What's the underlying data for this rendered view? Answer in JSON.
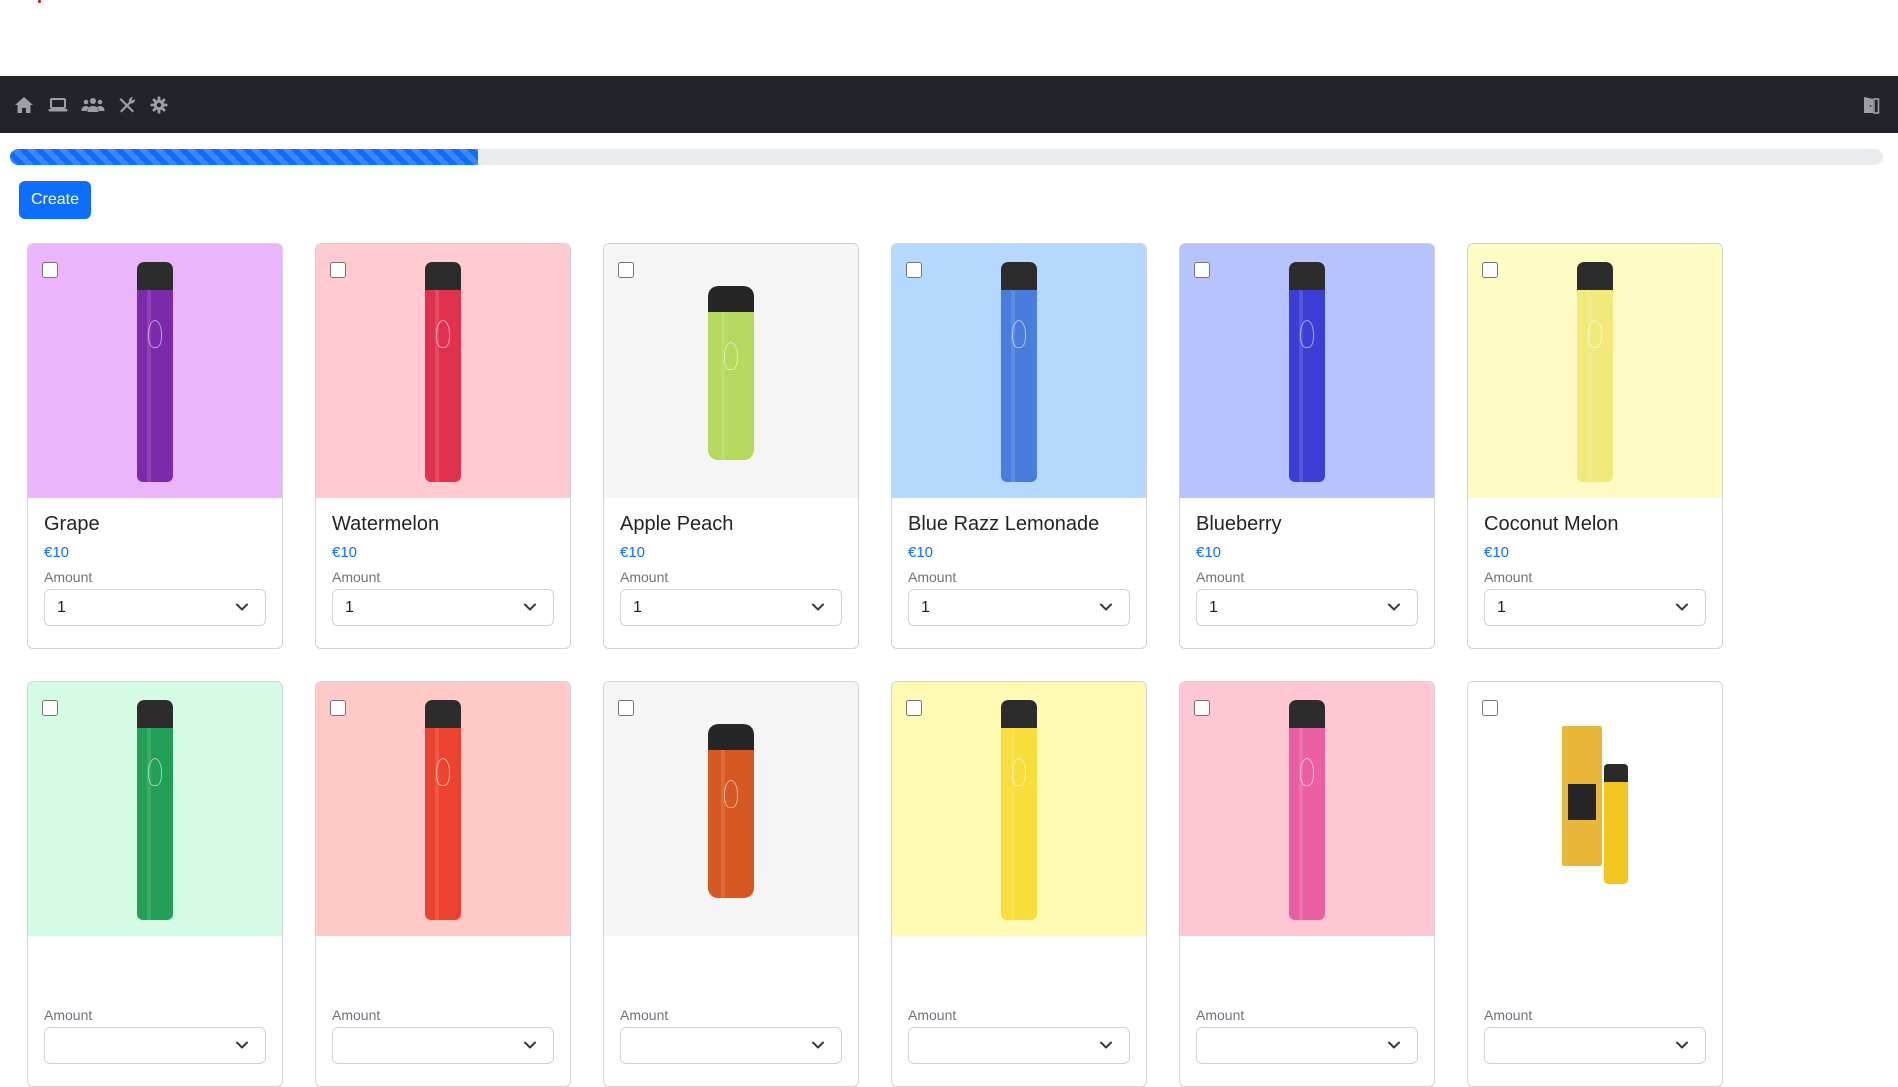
{
  "nav": {
    "icons": [
      "home-icon",
      "laptop-icon",
      "users-icon",
      "tools-icon",
      "gear-icon"
    ],
    "right_icon": "door-icon"
  },
  "progress": {
    "value_percent": 25,
    "color": "#0d6efd"
  },
  "create_label": "Create",
  "amount_label": "Amount",
  "products": [
    {
      "name": "Grape",
      "price": "€10",
      "amount": "1",
      "bg": "#eab5fb",
      "color": "#7b2aaa",
      "style": "tall"
    },
    {
      "name": "Watermelon",
      "price": "€10",
      "amount": "1",
      "bg": "#ffcbd1",
      "color": "#e0324e",
      "style": "tall"
    },
    {
      "name": "Apple Peach",
      "price": "€10",
      "amount": "1",
      "bg": "#f5f5f5",
      "color": "#b5d85e",
      "style": "short"
    },
    {
      "name": "Blue Razz Lemonade",
      "price": "€10",
      "amount": "1",
      "bg": "#b4d8fe",
      "color": "#4a7ddb",
      "style": "tall"
    },
    {
      "name": "Blueberry",
      "price": "€10",
      "amount": "1",
      "bg": "#b7c3fc",
      "color": "#3b3fd6",
      "style": "tall"
    },
    {
      "name": "Coconut Melon",
      "price": "€10",
      "amount": "1",
      "bg": "#fdfac3",
      "color": "#f1e97a",
      "style": "tall"
    },
    {
      "name": "",
      "price": "",
      "amount": "",
      "bg": "#d6fbe4",
      "color": "#22a057",
      "style": "tall"
    },
    {
      "name": "",
      "price": "",
      "amount": "",
      "bg": "#ffc9c6",
      "color": "#ec4330",
      "style": "tall"
    },
    {
      "name": "",
      "price": "",
      "amount": "",
      "bg": "#f5f5f5",
      "color": "#d65822",
      "style": "short"
    },
    {
      "name": "",
      "price": "",
      "amount": "",
      "bg": "#fffab3",
      "color": "#f7de3a",
      "style": "tall"
    },
    {
      "name": "",
      "price": "",
      "amount": "",
      "bg": "#ffc7d4",
      "color": "#ea5fa2",
      "style": "tall"
    },
    {
      "name": "",
      "price": "",
      "amount": "",
      "bg": "#ffffff",
      "color": "#f2c51f",
      "style": "box"
    }
  ]
}
